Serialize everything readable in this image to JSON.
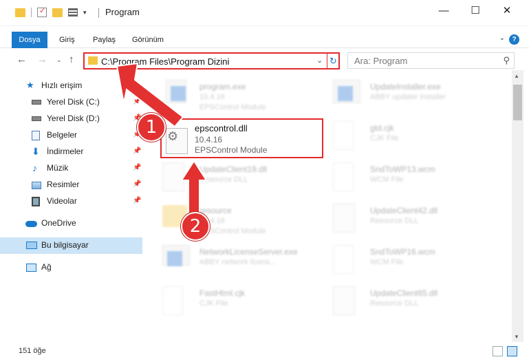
{
  "window": {
    "title": "Program",
    "minimize_label": "—",
    "maximize_label": "☐",
    "close_label": "✕"
  },
  "ribbon": {
    "tabs": [
      "Dosya",
      "Giriş",
      "Paylaş",
      "Görünüm"
    ],
    "help_label": "?"
  },
  "nav": {
    "address": "C:\\Program Files\\Program Dizini",
    "search_placeholder": "Ara: Program"
  },
  "sidebar": {
    "items": [
      {
        "label": "Hızlı erişim",
        "icon": "star-icon"
      },
      {
        "label": "Yerel Disk (C:)",
        "icon": "drive-icon",
        "pinned": true
      },
      {
        "label": "Yerel Disk (D:)",
        "icon": "drive-icon",
        "pinned": true
      },
      {
        "label": "Belgeler",
        "icon": "documents-icon",
        "pinned": true
      },
      {
        "label": "İndirmeler",
        "icon": "download-icon",
        "pinned": true
      },
      {
        "label": "Müzik",
        "icon": "music-icon",
        "pinned": true
      },
      {
        "label": "Resimler",
        "icon": "pictures-icon",
        "pinned": true
      },
      {
        "label": "Videolar",
        "icon": "video-icon",
        "pinned": true
      },
      {
        "label": "OneDrive",
        "icon": "cloud-icon"
      },
      {
        "label": "Bu bilgisayar",
        "icon": "computer-icon",
        "selected": true
      },
      {
        "label": "Ağ",
        "icon": "network-icon"
      }
    ]
  },
  "files": {
    "left": [
      {
        "name": "program.exe",
        "l2": "10.4.16",
        "l3": "EPSControl Module"
      },
      {
        "name": "UpdateClient19.dll",
        "l2": "Resource DLL",
        "l3": ""
      },
      {
        "name": "resource",
        "l2": "10.4.16",
        "l3": "EPSControl Module"
      },
      {
        "name": "NetworkLicenseServer.exe",
        "l2": "ABBY network licens...",
        "l3": ""
      },
      {
        "name": "FastHtml.cjk",
        "l2": "CJK File",
        "l3": ""
      }
    ],
    "right": [
      {
        "name": "UpdateInstaller.exe",
        "l2": "ABBY updater installer",
        "l3": ""
      },
      {
        "name": "gtd.cjk",
        "l2": "CJK File",
        "l3": ""
      },
      {
        "name": "SndToWP13.wcm",
        "l2": "WCM File",
        "l3": ""
      },
      {
        "name": "UpdateClient42.dll",
        "l2": "Resource DLL",
        "l3": ""
      },
      {
        "name": "SndToWP16.wcm",
        "l2": "WCM File",
        "l3": ""
      },
      {
        "name": "UpdateClient65.dll",
        "l2": "Resource DLL",
        "l3": ""
      }
    ],
    "highlighted": {
      "name": "epscontrol.dll",
      "l2": "10.4.16",
      "l3": "EPSControl Module"
    }
  },
  "annotations": {
    "step1": "1",
    "step2": "2"
  },
  "status": {
    "count": "151 öğe"
  },
  "colors": {
    "accent": "#1979ca",
    "highlight_red": "#e32a2a",
    "selected": "#cce4f7"
  }
}
